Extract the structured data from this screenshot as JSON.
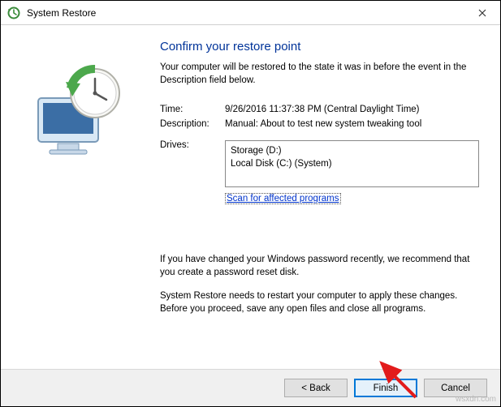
{
  "window": {
    "title": "System Restore"
  },
  "heading": "Confirm your restore point",
  "subtext": "Your computer will be restored to the state it was in before the event in the Description field below.",
  "info": {
    "time_label": "Time:",
    "time_value": "9/26/2016 11:37:38 PM (Central Daylight Time)",
    "desc_label": "Description:",
    "desc_value": "Manual: About to test new system tweaking tool",
    "drives_label": "Drives:",
    "drives": [
      "Storage (D:)",
      "Local Disk (C:) (System)"
    ]
  },
  "scan_link": "Scan for affected programs",
  "note_password": "If you have changed your Windows password recently, we recommend that you create a password reset disk.",
  "note_restart": "System Restore needs to restart your computer to apply these changes. Before you proceed, save any open files and close all programs.",
  "buttons": {
    "back": "< Back",
    "finish": "Finish",
    "cancel": "Cancel"
  },
  "watermark": "wsxdn.com"
}
